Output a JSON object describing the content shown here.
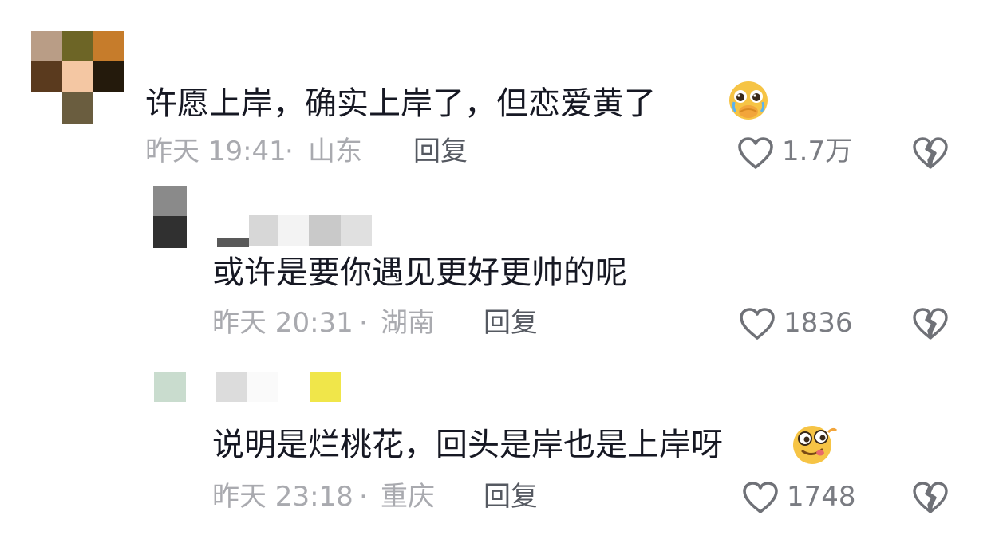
{
  "comments": [
    {
      "text": "许愿上岸，确实上岸了，但恋爱黄了",
      "emoji_icon": "crying-pleading-face-icon",
      "time": "昨天 19:41",
      "location": "山东",
      "reply_label": "回复",
      "like_count": "1.7万",
      "like_icon": "heart-outline-icon",
      "dislike_icon": "broken-heart-icon"
    },
    {
      "text": "或许是要你遇见更好更帅的呢",
      "time": "昨天 20:31",
      "location": "湖南",
      "reply_label": "回复",
      "like_count": "1836",
      "like_icon": "heart-outline-icon",
      "dislike_icon": "broken-heart-icon"
    },
    {
      "text": "说明是烂桃花，回头是岸也是上岸呀",
      "emoji_icon": "wink-tongue-face-icon",
      "time": "昨天 23:18",
      "location": "重庆",
      "reply_label": "回复",
      "like_count": "1748",
      "like_icon": "heart-outline-icon",
      "dislike_icon": "broken-heart-icon"
    }
  ],
  "meta_separator": "·",
  "colors": {
    "text_primary": "#161823",
    "text_meta": "#a9aaaf",
    "text_reply": "#555961",
    "icon_gray": "#6f7177"
  }
}
